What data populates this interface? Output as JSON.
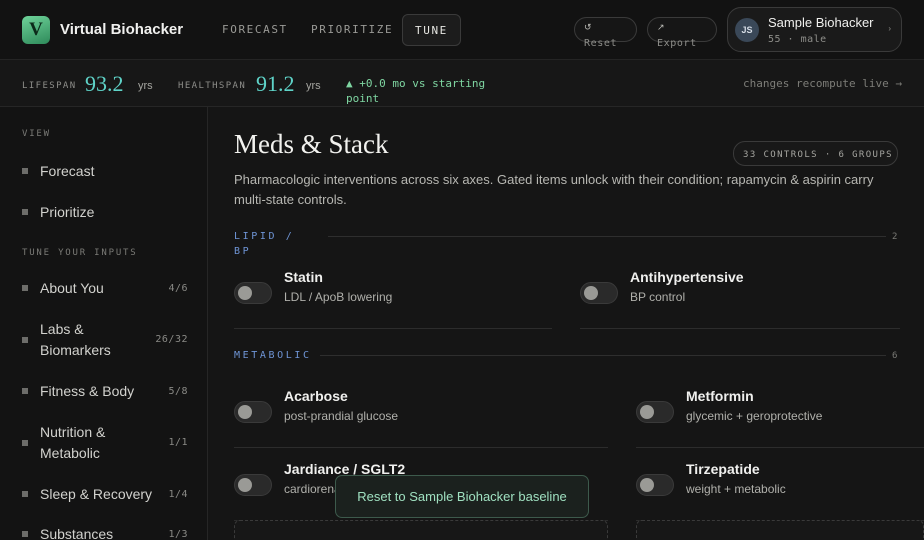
{
  "app": {
    "logo_letter": "V",
    "title": "Virtual Biohacker"
  },
  "nav": {
    "tabs": [
      {
        "label": "FORECAST"
      },
      {
        "label": "PRIORITIZE"
      },
      {
        "label": "TUNE"
      }
    ],
    "active": "TUNE"
  },
  "header_buttons": {
    "reset_icon": "↺",
    "reset_label": "Reset",
    "export_icon": "↗",
    "export_label": "Export"
  },
  "profile": {
    "initials": "JS",
    "name": "Sample Biohacker",
    "meta": "55 · male",
    "chevron": "›"
  },
  "stats": {
    "lifespan_label": "LIFESPAN",
    "lifespan_value": "93.2",
    "lifespan_unit": "yrs",
    "healthspan_label": "HEALTHSPAN",
    "healthspan_value": "91.2",
    "healthspan_unit": "yrs",
    "delta": "▲ +0.0 mo vs starting point",
    "recompute": "changes recompute live →"
  },
  "sidebar": {
    "view_heading": "VIEW",
    "view_items": [
      {
        "label": "Forecast"
      },
      {
        "label": "Prioritize"
      }
    ],
    "tune_heading": "TUNE YOUR INPUTS",
    "tune_items": [
      {
        "label": "About You",
        "count": "4/6"
      },
      {
        "label": "Labs & Biomarkers",
        "count": "26/32"
      },
      {
        "label": "Fitness & Body",
        "count": "5/8"
      },
      {
        "label": "Nutrition & Metabolic",
        "count": "1/1"
      },
      {
        "label": "Sleep & Recovery",
        "count": "1/4"
      },
      {
        "label": "Substances",
        "count": "1/3"
      }
    ]
  },
  "main": {
    "title": "Meds & Stack",
    "description": "Pharmacologic interventions across six axes. Gated items unlock with their condition; rapamycin & aspirin carry multi-state controls.",
    "controls_badge": "33 CONTROLS · 6 GROUPS",
    "groups": [
      {
        "heading": "LIPID / BP",
        "count": "2",
        "controls": [
          {
            "name": "Statin",
            "sub": "LDL / ApoB lowering",
            "on": false
          },
          {
            "name": "Antihypertensive",
            "sub": "BP control",
            "on": false
          }
        ]
      },
      {
        "heading": "METABOLIC",
        "count": "6",
        "controls": [
          {
            "name": "Acarbose",
            "sub": "post-prandial glucose",
            "on": false
          },
          {
            "name": "Metformin",
            "sub": "glycemic + geroprotective",
            "on": false
          },
          {
            "name": "Jardiance / SGLT2",
            "sub": "cardiorenal",
            "on": false
          },
          {
            "name": "Tirzepatide",
            "sub": "weight + metabolic",
            "on": false
          }
        ]
      }
    ]
  },
  "toast": {
    "label": "Reset to Sample Biohacker baseline"
  },
  "colors": {
    "accent_teal": "#5fd3c8",
    "accent_green": "#7fd6a2",
    "group_blue": "#6f95d6",
    "background": "#151515"
  }
}
